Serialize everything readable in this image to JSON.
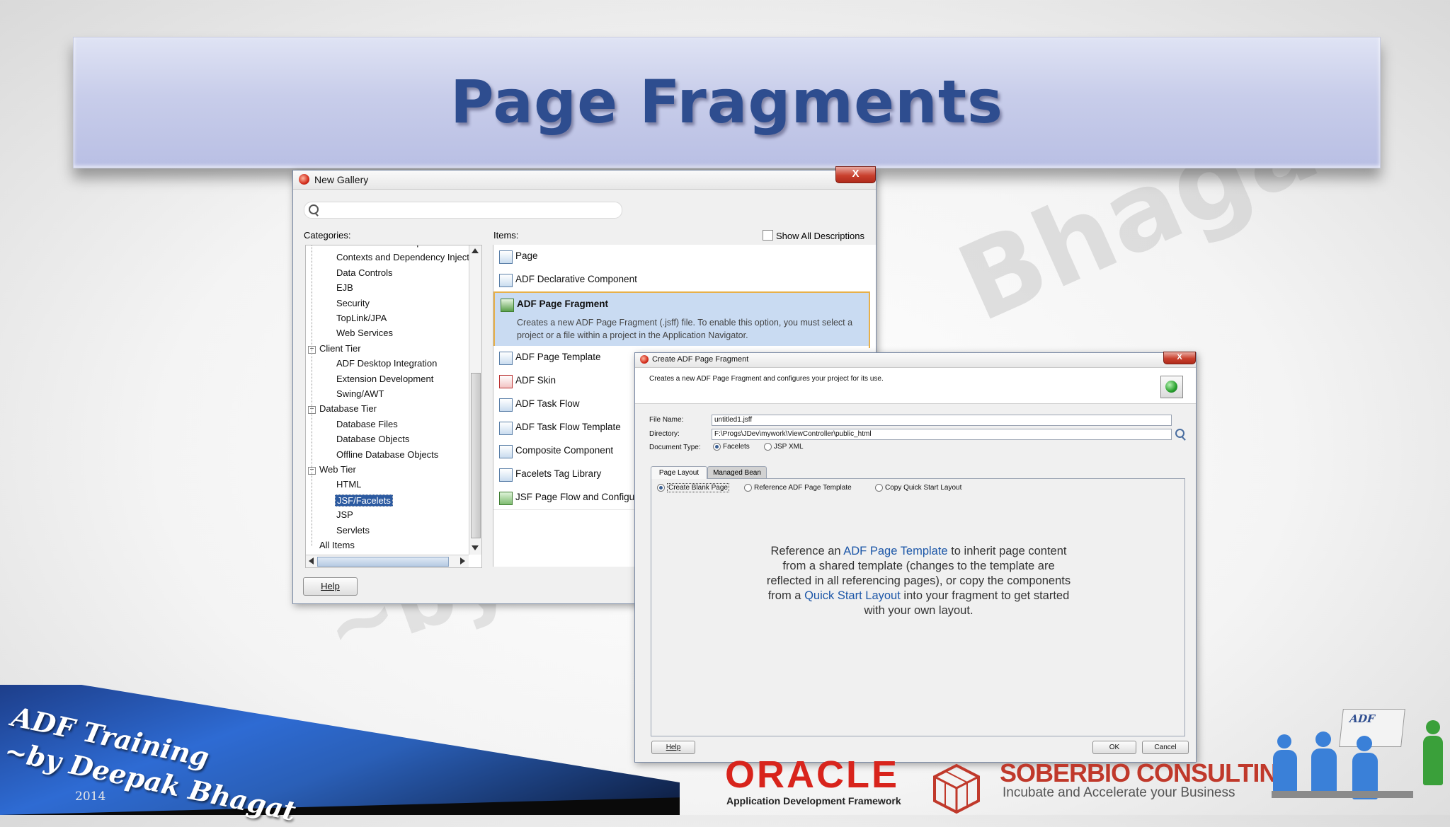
{
  "slide": {
    "title": "Page Fragments",
    "watermark_name": "Bhagat",
    "watermark_by": "~by"
  },
  "new_gallery": {
    "title": "New Gallery",
    "close_label": "X",
    "search_placeholder": "",
    "categories_label": "Categories:",
    "items_label": "Items:",
    "show_all_label": "Show All Descriptions",
    "help_label": "Help",
    "categories": [
      {
        "label": "ADF Business Components",
        "level": 1
      },
      {
        "label": "Contexts and Dependency Inject",
        "level": 1
      },
      {
        "label": "Data Controls",
        "level": 1
      },
      {
        "label": "EJB",
        "level": 1
      },
      {
        "label": "Security",
        "level": 1
      },
      {
        "label": "TopLink/JPA",
        "level": 1
      },
      {
        "label": "Web Services",
        "level": 1
      },
      {
        "label": "Client Tier",
        "level": 0
      },
      {
        "label": "ADF Desktop Integration",
        "level": 1
      },
      {
        "label": "Extension Development",
        "level": 1
      },
      {
        "label": "Swing/AWT",
        "level": 1
      },
      {
        "label": "Database Tier",
        "level": 0
      },
      {
        "label": "Database Files",
        "level": 1
      },
      {
        "label": "Database Objects",
        "level": 1
      },
      {
        "label": "Offline Database Objects",
        "level": 1
      },
      {
        "label": "Web Tier",
        "level": 0
      },
      {
        "label": "HTML",
        "level": 1
      },
      {
        "label": "JSF/Facelets",
        "level": 1,
        "selected": true
      },
      {
        "label": "JSP",
        "level": 1
      },
      {
        "label": "Servlets",
        "level": 1
      },
      {
        "label": "All Items",
        "level": 0
      }
    ],
    "items": [
      {
        "label": "Page"
      },
      {
        "label": "ADF Declarative Component"
      },
      {
        "label": "ADF Page Fragment",
        "selected": true,
        "description": "Creates a new ADF Page Fragment (.jsff) file. To enable this option, you must select a project or a file within a project in the Application Navigator."
      },
      {
        "label": "ADF Page Template"
      },
      {
        "label": "ADF Skin"
      },
      {
        "label": "ADF Task Flow"
      },
      {
        "label": "ADF Task Flow Template"
      },
      {
        "label": "Composite Component"
      },
      {
        "label": "Facelets Tag Library"
      },
      {
        "label": "JSF Page Flow and Configurat"
      }
    ]
  },
  "create_dialog": {
    "title": "Create ADF Page Fragment",
    "close_label": "X",
    "subtitle": "Creates a new ADF Page Fragment and configures your project for its use.",
    "file_name_label": "File Name:",
    "file_name_value": "untitled1.jsff",
    "directory_label": "Directory:",
    "directory_value": "F:\\Progs\\JDev\\mywork\\ViewController\\public_html",
    "doc_type_label": "Document Type:",
    "doc_type_options": [
      "Facelets",
      "JSP XML"
    ],
    "tabs": [
      "Page Layout",
      "Managed Bean"
    ],
    "layout_options": [
      "Create Blank Page",
      "Reference ADF Page Template",
      "Copy Quick Start Layout"
    ],
    "description": {
      "part1": "Reference an ",
      "link1": "ADF Page Template",
      "part2": " to inherit page content from a shared template (changes to the template are reflected in all referencing pages), or copy the components from a ",
      "link2": "Quick Start Layout",
      "part3": " into your fragment to get started with your own layout."
    },
    "help_label": "Help",
    "ok_label": "OK",
    "cancel_label": "Cancel"
  },
  "footer": {
    "training_line1": "ADF Training",
    "training_line2": "~by Deepak Bhagat",
    "year": "2014",
    "oracle_logo": "ORACLE",
    "oracle_sub": "Application Development Framework",
    "soberbio_name": "SOBERBIO CONSULTING",
    "soberbio_tagline": "Incubate and Accelerate your Business",
    "adf_badge": "ADF"
  },
  "colors": {
    "title": "#2e4d8f",
    "selection": "#2c5aa0",
    "link": "#1d57a8",
    "oracle_red": "#d8241c"
  }
}
